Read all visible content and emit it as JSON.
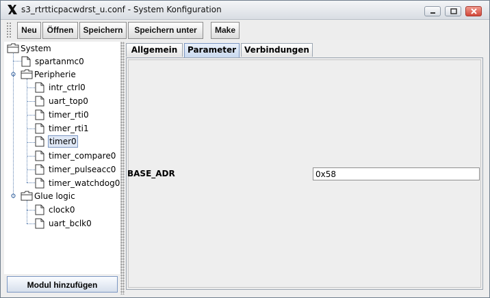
{
  "window": {
    "title": "s3_rtrtticpacwdrst_u.conf - System Konfiguration",
    "logo": "x-logo-icon"
  },
  "window_controls": [
    "minimize-icon",
    "maximize-icon",
    "close-icon"
  ],
  "toolbar": {
    "buttons": [
      "Neu",
      "Öffnen",
      "Speichern",
      "Speichern unter",
      "Make"
    ]
  },
  "tree": {
    "nodes": [
      {
        "label": "System",
        "icon": "folder-open-icon"
      },
      {
        "label": "spartanmc0",
        "icon": "file-icon"
      },
      {
        "label": "Peripherie",
        "icon": "folder-open-icon"
      },
      {
        "label": "intr_ctrl0",
        "icon": "file-icon"
      },
      {
        "label": "uart_top0",
        "icon": "file-icon"
      },
      {
        "label": "timer_rti0",
        "icon": "file-icon"
      },
      {
        "label": "timer_rti1",
        "icon": "file-icon"
      },
      {
        "label": "timer0",
        "icon": "file-icon",
        "selected": true
      },
      {
        "label": "timer_compare0",
        "icon": "file-icon"
      },
      {
        "label": "timer_pulseacc0",
        "icon": "file-icon"
      },
      {
        "label": "timer_watchdog0",
        "icon": "file-icon"
      },
      {
        "label": "Glue logic",
        "icon": "folder-open-icon"
      },
      {
        "label": "clock0",
        "icon": "file-icon"
      },
      {
        "label": "uart_bclk0",
        "icon": "file-icon"
      }
    ],
    "add_button": "Modul hinzufügen"
  },
  "tabs": [
    {
      "label": "Allgemein",
      "active": false
    },
    {
      "label": "Parameter",
      "active": true
    },
    {
      "label": "Verbindungen",
      "active": false
    }
  ],
  "parameters": [
    {
      "name": "BASE_ADR",
      "value": "0x58"
    }
  ],
  "colors": {
    "selection_border": "#7a96c2",
    "selection_fill": "#dfe8f6",
    "close_button": "#d2483a",
    "tree_lines": "#5a7fb0"
  }
}
